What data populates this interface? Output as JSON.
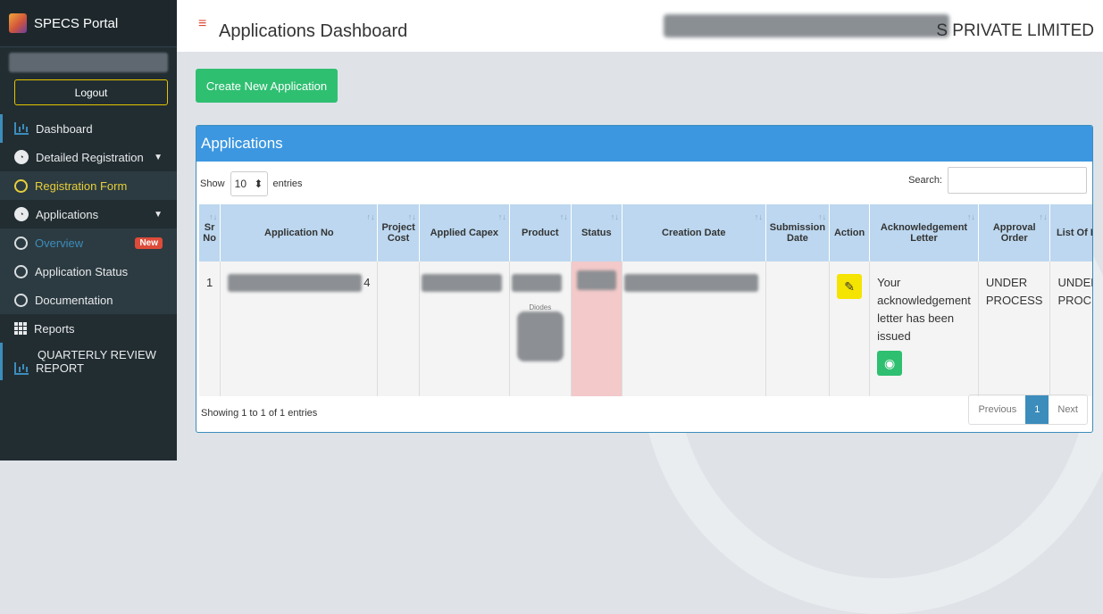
{
  "sidebar": {
    "brand": "SPECS Portal",
    "logout": "Logout",
    "dashboard": "Dashboard",
    "detailed_registration": "Detailed Registration",
    "registration_form": "Registration Form",
    "applications": "Applications",
    "overview": "Overview",
    "new_badge": "New",
    "application_status": "Application Status",
    "documentation": "Documentation",
    "reports": "Reports",
    "qr_line1": "QUARTERLY REVIEW",
    "qr_line2": "REPORT"
  },
  "header": {
    "title": "Applications Dashboard",
    "company": "S PRIVATE LIMITED"
  },
  "main": {
    "create_button": "Create New Application",
    "panel_title": "Applications",
    "show_label": "Show",
    "entries_value": "10",
    "entries_label": "entries",
    "search_label": "Search:",
    "columns": [
      "Sr No",
      "Application No",
      "Project Cost",
      "Applied Capex",
      "Product",
      "Status",
      "Creation Date",
      "Submission Date",
      "Action",
      "Acknowledgement Letter",
      "Approval Order",
      "List Of Items"
    ],
    "row": {
      "sr": "1",
      "app_no_suffix": "4",
      "product_text": "Diodes",
      "ack_letter": "Your acknowledgement letter has been issued",
      "approval": "UNDER PROCESS",
      "items": "UNDER PROCESS"
    },
    "footer_text": "Showing 1 to 1 of 1 entries",
    "pager": {
      "prev": "Previous",
      "current": "1",
      "next": "Next"
    }
  },
  "colors": {
    "accent": "#3c8dbc",
    "create": "#2fbf71",
    "sidebar": "#222d32"
  }
}
